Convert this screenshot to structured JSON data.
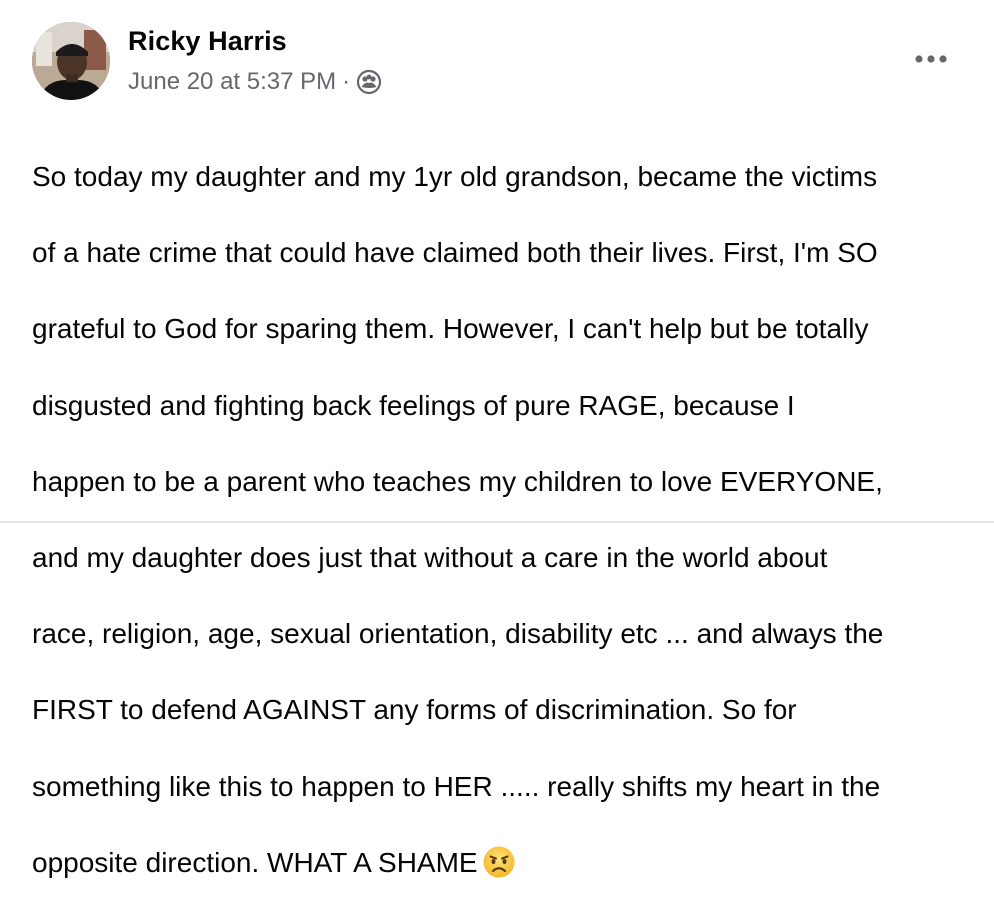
{
  "post": {
    "author": "Ricky Harris",
    "timestamp": "June 20 at 5:37 PM",
    "separator": "·",
    "audience_icon": "friends-icon",
    "more_icon": "more-options-icon",
    "avatar_icon": "profile-photo",
    "emoji": "frowning-face-icon",
    "lines": [
      "So today my daughter and my 1yr old grandson, became the victims",
      "of a hate crime that could have claimed both their lives. First, I'm SO",
      "grateful to God for sparing them. However, I can't help but be totally",
      "disgusted and fighting back feelings of pure RAGE, because I",
      "happen to be a parent who teaches my children to love EVERYONE,",
      "and my daughter does just that without a care in the world about",
      "race, religion, age, sexual orientation, disability etc ... and always the",
      "FIRST to defend AGAINST any forms of discrimination. So for",
      "something like this to happen to HER ..... really shifts my heart in the",
      "opposite direction. WHAT A SHAME"
    ]
  }
}
